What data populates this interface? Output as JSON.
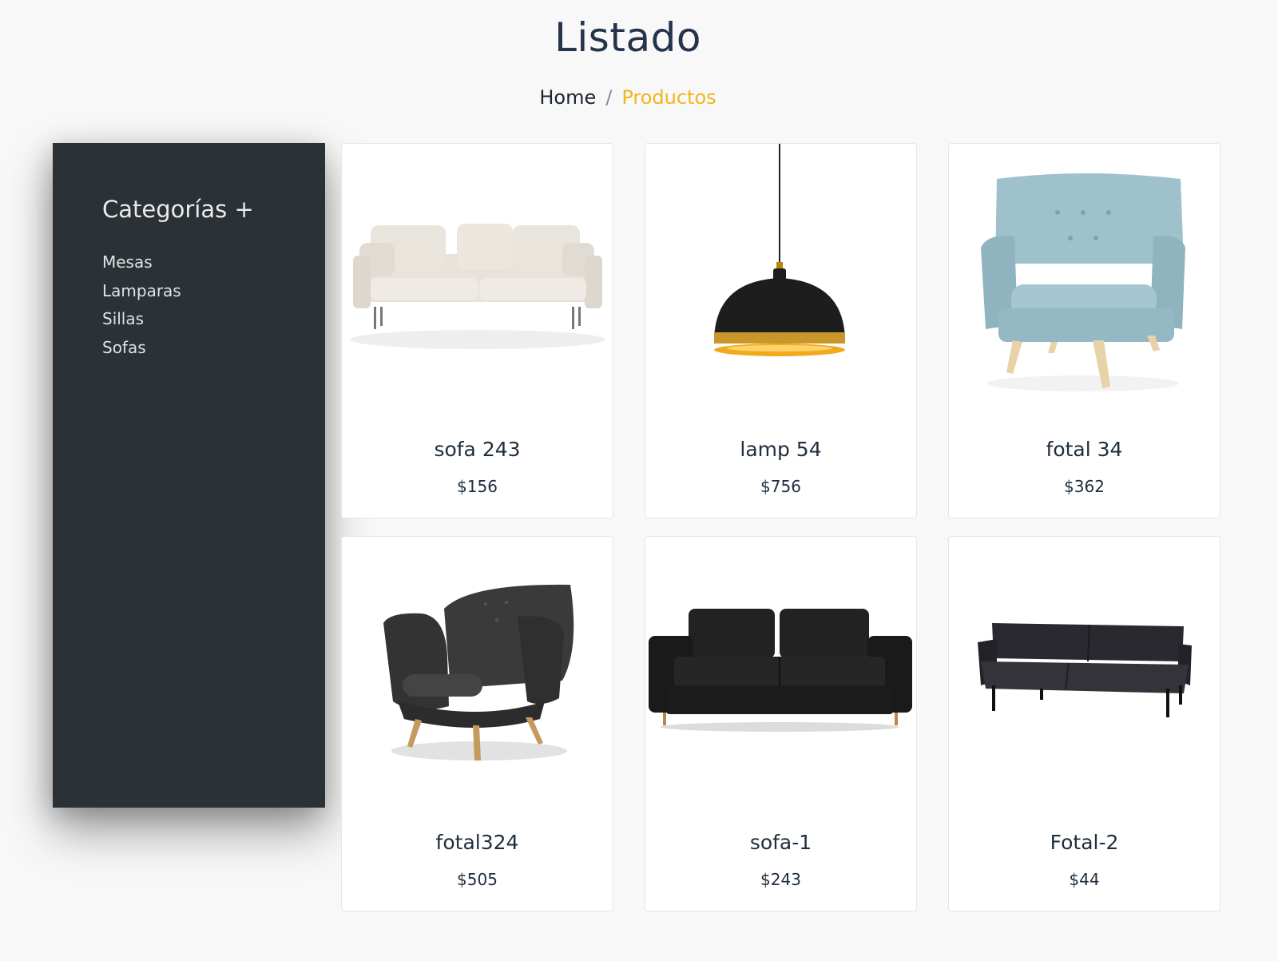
{
  "header": {
    "title": "Listado",
    "breadcrumb": {
      "home": "Home",
      "separator": "/",
      "current": "Productos"
    }
  },
  "sidebar": {
    "title": "Categorías +",
    "items": [
      {
        "label": "Mesas"
      },
      {
        "label": "Lamparas"
      },
      {
        "label": "Sillas"
      },
      {
        "label": "Sofas"
      }
    ]
  },
  "products": [
    {
      "name": "sofa 243",
      "price": "$156",
      "image": "cream-sofa"
    },
    {
      "name": "lamp 54",
      "price": "$756",
      "image": "black-pendant-lamp"
    },
    {
      "name": "fotal 34",
      "price": "$362",
      "image": "light-blue-armchair"
    },
    {
      "name": "fotal324",
      "price": "$505",
      "image": "dark-grey-armchair"
    },
    {
      "name": "sofa-1",
      "price": "$243",
      "image": "black-sofa"
    },
    {
      "name": "Fotal-2",
      "price": "$44",
      "image": "dark-futon-sofa"
    }
  ],
  "colors": {
    "accent": "#f2b51c",
    "sidebar_bg": "#2b3135",
    "page_bg": "#f8f8f8",
    "text_dark": "#1f2d3d"
  }
}
